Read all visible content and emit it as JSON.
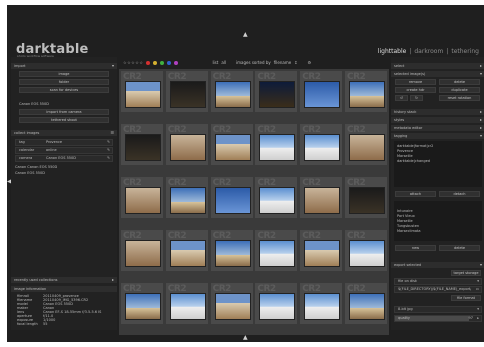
{
  "app": {
    "logo": "darktable",
    "tagline": "photo workflow software"
  },
  "views": {
    "items": [
      "lighttable",
      "darkroom",
      "tethering"
    ],
    "separator": "|"
  },
  "toolbar": {
    "stars": "☆☆☆☆☆",
    "dot_colors": [
      "#d43030",
      "#d4b030",
      "#40b040",
      "#3060d0",
      "#b040c0"
    ],
    "zoom_label": "list",
    "zoom_value": "all",
    "sort_label": "images sorted by",
    "sort_value": "filename"
  },
  "left": {
    "import": {
      "title": "import",
      "buttons": [
        "image",
        "folder",
        "scan for devices"
      ],
      "camera": "Canon EOS 550D",
      "camera_buttons": [
        "import from camera",
        "tethered shoot"
      ]
    },
    "collect": {
      "title": "collect images",
      "rules": [
        {
          "field": "tag",
          "value": "Provence"
        },
        {
          "field": "calendar",
          "value": "online"
        },
        {
          "field": "camera",
          "value": "Canon EOS 550D"
        }
      ],
      "results": [
        "Canon Canon EOS 550D",
        "Canon EOS 550D"
      ]
    },
    "recent": {
      "title": "recently used collections"
    },
    "info": {
      "title": "image information",
      "rows": [
        {
          "k": "filmroll",
          "v": "20110409_provence"
        },
        {
          "k": "filename",
          "v": "20110409_IMG_5396.CR2"
        },
        {
          "k": "model",
          "v": "Canon EOS 550D"
        },
        {
          "k": "maker",
          "v": "Canon"
        },
        {
          "k": "lens",
          "v": "Canon EF-S 18-55mm f/3.5-5.6 IS"
        },
        {
          "k": "aperture",
          "v": "f/11.0"
        },
        {
          "k": "exposure",
          "v": "1/1000"
        },
        {
          "k": "focal length",
          "v": "55"
        }
      ]
    }
  },
  "grid": {
    "badge": "CR2",
    "thumbs": [
      "town",
      "dark",
      "sky",
      "night",
      "blue",
      "sky",
      "dark",
      "arch",
      "town",
      "sea",
      "sea",
      "arch",
      "arch",
      "sky",
      "blue",
      "sea",
      "arch",
      "dark",
      "arch",
      "town",
      "sky",
      "sea",
      "town",
      "sea",
      "sky",
      "sea",
      "town",
      "sea",
      "sea",
      "sky"
    ]
  },
  "right": {
    "select": {
      "title": "select"
    },
    "selected": {
      "title": "selected image(s)",
      "buttons": [
        "remove",
        "delete",
        "create hdr",
        "duplicate",
        "reset rotation"
      ]
    },
    "history": {
      "title": "history stack"
    },
    "styles": {
      "title": "styles"
    },
    "metadata": {
      "title": "metadata editor"
    },
    "tagging": {
      "title": "tagging",
      "attached": [
        "darktable|format|cr2",
        "Provence",
        "Marseille",
        "darktable|changed"
      ],
      "attach": "attach",
      "detach": "detach",
      "suggestions": [
        "Intunaire",
        "Port Vieux",
        "Marseille",
        "Tungsbusten",
        "Marseclimata"
      ],
      "new": "new",
      "delete": "delete"
    },
    "export": {
      "title": "export selected",
      "target_storage": "target storage",
      "storage": "file on disk",
      "path": "$(FILE_DIRECTORY)/$(FILE_NAME)_export/$(FILE_NAME)",
      "file_format": "file format",
      "format": "8-bit jpg",
      "quality_label": "quality",
      "quality_value": "97"
    }
  }
}
